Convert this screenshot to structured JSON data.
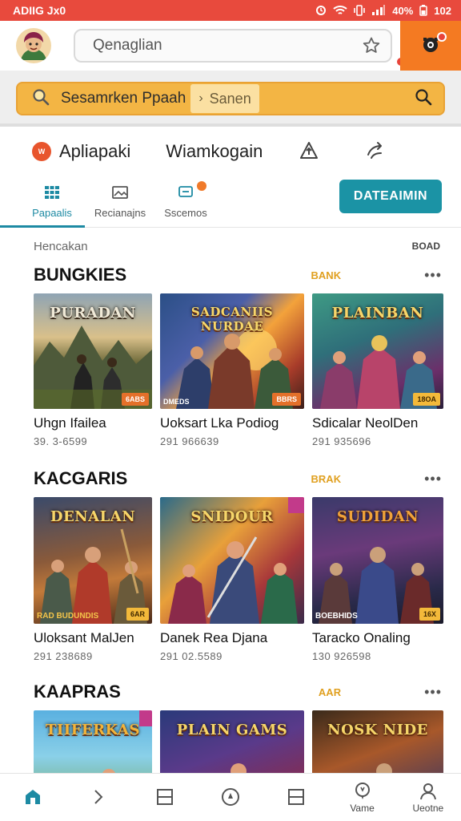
{
  "status_bar": {
    "left_text": "ADIIG Jx0",
    "battery": "40%",
    "time": "102"
  },
  "topbar": {
    "url_text": "Qenaglian"
  },
  "search": {
    "text": "Sesamrken Ppaah",
    "chip": "Sanen"
  },
  "app_header": {
    "badge": "W",
    "name": "Apliapaki",
    "subtitle": "Wiamkogain"
  },
  "tabs": [
    {
      "label": "Papaalis",
      "icon": "grid-icon"
    },
    {
      "label": "Recianajns",
      "icon": "image-icon"
    },
    {
      "label": "Sscemos",
      "icon": "chat-icon"
    }
  ],
  "action_button": "DATEAIMIN",
  "meta": {
    "left": "Hencakan",
    "right": "BOAD"
  },
  "sections": [
    {
      "title": "BUNGKIES",
      "tag": "BANK",
      "items": [
        {
          "art_title": "PURADAN",
          "name": "Uhgn Ifailea",
          "count": "39. 3-6599",
          "badge": "6ABS",
          "badge_style": "orange",
          "sub": ""
        },
        {
          "art_title": "SADCANIIS NURDAE",
          "name": "Uoksart Lka Podiog",
          "count": "291 966639",
          "badge": "BBRS",
          "badge_style": "orange",
          "sub": "DMEDS"
        },
        {
          "art_title": "PLAINBAN",
          "name": "Sdicalar NeolDen",
          "count": "291 935696",
          "badge": "18OA",
          "badge_style": "gold",
          "sub": ""
        }
      ]
    },
    {
      "title": "KACGARIS",
      "tag": "BRAK",
      "items": [
        {
          "art_title": "DENALAN",
          "name": "Uloksant MalJen",
          "count": "291 238689",
          "badge": "6AR",
          "badge_style": "gold",
          "sub": "RAD BUDUNDIS"
        },
        {
          "art_title": "SNIDOUR",
          "name": "Danek Rea Djana",
          "count": "291 02.5589",
          "badge": "",
          "badge_style": "",
          "sub": ""
        },
        {
          "art_title": "SUDIDAN",
          "name": "Taracko Onaling",
          "count": "130 926598",
          "badge": "16X",
          "badge_style": "gold",
          "sub": "BOEBHIDS"
        }
      ]
    },
    {
      "title": "KAAPRAS",
      "tag": "AAR",
      "items": [
        {
          "art_title": "TIIFERKAS",
          "name": "",
          "count": "",
          "badge": "",
          "badge_style": "",
          "sub": ""
        },
        {
          "art_title": "PLAIN GAMS",
          "name": "",
          "count": "",
          "badge": "",
          "badge_style": "",
          "sub": ""
        },
        {
          "art_title": "NOSK NIDE",
          "name": "",
          "count": "",
          "badge": "",
          "badge_style": "",
          "sub": ""
        }
      ]
    }
  ],
  "bottom_nav": [
    {
      "icon": "home-icon",
      "label": ""
    },
    {
      "icon": "chevron-right-icon",
      "label": ""
    },
    {
      "icon": "box-icon",
      "label": ""
    },
    {
      "icon": "compass-icon",
      "label": ""
    },
    {
      "icon": "box-icon",
      "label": ""
    },
    {
      "icon": "chat-bubble-icon",
      "label": "Vame"
    },
    {
      "icon": "person-icon",
      "label": "Ueotne"
    }
  ],
  "colors": {
    "status_bar": "#e84a3d",
    "accent": "#1b93a5",
    "search": "#f3b544",
    "orange": "#f47a22"
  }
}
